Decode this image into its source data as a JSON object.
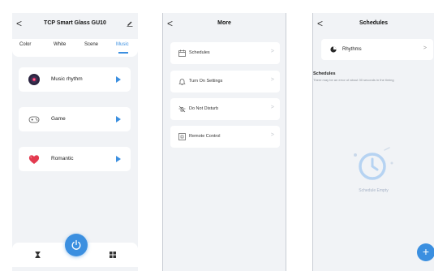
{
  "screen1": {
    "back": "<",
    "title": "TCP Smart Glass GU10",
    "tabs": [
      "Color",
      "White",
      "Scene",
      "Music"
    ],
    "active_tab": "Music",
    "cards": [
      {
        "label": "Music rhythm",
        "icon": "vinyl-record-icon"
      },
      {
        "label": "Game",
        "icon": "gamepad-icon"
      },
      {
        "label": "Romantic",
        "icon": "hearts-icon"
      }
    ],
    "bottom_icons": [
      "hourglass-icon",
      "power-icon",
      "grid-icon"
    ],
    "accent": "#3b8fe0"
  },
  "screen2": {
    "back": "<",
    "title": "More",
    "items": [
      {
        "label": "Schedules",
        "icon": "calendar-icon"
      },
      {
        "label": "Turn On Settings",
        "icon": "bell-icon"
      },
      {
        "label": "Do Not Disturb",
        "icon": "dnd-icon"
      },
      {
        "label": "Remote Control",
        "icon": "remote-icon"
      }
    ],
    "chevron": ">"
  },
  "screen3": {
    "back": "<",
    "title": "Schedules",
    "rhythm": {
      "label": "Rhythms",
      "chevron": ">"
    },
    "section_title": "Schedules",
    "note": "There may be an error of about 30 seconds in the timing",
    "empty": "Schedule Empty",
    "fab": "+"
  }
}
